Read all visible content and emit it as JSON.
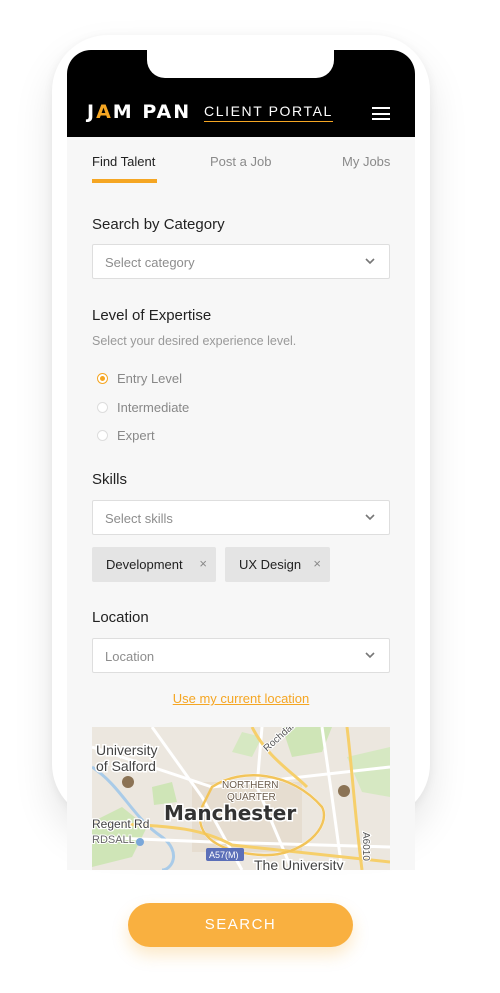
{
  "header": {
    "brand_left": "J",
    "brand_accent": "A",
    "brand_right": "M PAN",
    "portal_title": "CLIENT PORTAL",
    "menu_icon": "hamburger-icon"
  },
  "tabs": [
    {
      "label": "Find Talent",
      "active": true
    },
    {
      "label": "Post a Job",
      "active": false
    },
    {
      "label": "My Jobs",
      "active": false
    }
  ],
  "category": {
    "label": "Search by Category",
    "placeholder": "Select category"
  },
  "expertise": {
    "label": "Level of Expertise",
    "helper": "Select your desired experience level.",
    "options": [
      {
        "label": "Entry Level",
        "selected": true
      },
      {
        "label": "Intermediate",
        "selected": false
      },
      {
        "label": "Expert",
        "selected": false
      }
    ]
  },
  "skills": {
    "label": "Skills",
    "placeholder": "Select skills",
    "chips": [
      {
        "label": "Development",
        "remove": "×"
      },
      {
        "label": "UX Design",
        "remove": "×"
      }
    ]
  },
  "location": {
    "label": "Location",
    "placeholder": "Location",
    "current_location_link": "Use my current location"
  },
  "map": {
    "labels": {
      "university_of_salford_1": "University",
      "university_of_salford_2": "of Salford",
      "rochdale": "Rochdale",
      "northern_quarter_1": "NORTHERN",
      "northern_quarter_2": "QUARTER",
      "manchester": "Manchester",
      "regent_rd": "Regent Rd",
      "ordsall": "RDSALL",
      "a57m": "A57(M)",
      "a6010": "A6010",
      "the_university": "The University"
    }
  },
  "search_button": "SEARCH",
  "colors": {
    "accent": "#f5a623",
    "header_bg": "#000000",
    "button_bg": "#f9b040"
  }
}
